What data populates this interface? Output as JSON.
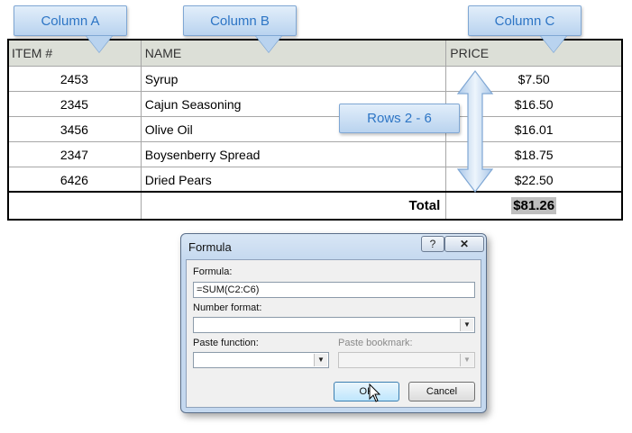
{
  "callouts": {
    "column_a": "Column A",
    "column_b": "Column B",
    "column_c": "Column C",
    "rows": "Rows 2 - 6"
  },
  "table": {
    "headers": [
      "ITEM #",
      "NAME",
      "PRICE"
    ],
    "rows": [
      {
        "item": "2453",
        "name": "Syrup",
        "price": "$7.50"
      },
      {
        "item": "2345",
        "name": "Cajun Seasoning",
        "price": "$16.50"
      },
      {
        "item": "3456",
        "name": "Olive Oil",
        "price": "$16.01"
      },
      {
        "item": "2347",
        "name": "Boysenberry Spread",
        "price": "$18.75"
      },
      {
        "item": "6426",
        "name": "Dried Pears",
        "price": "$22.50"
      }
    ],
    "total_label": "Total",
    "total_value": "$81.26"
  },
  "dialog": {
    "title": "Formula",
    "help_label": "?",
    "close_label": "✕",
    "formula_label": "Formula:",
    "formula_value": "=SUM(C2:C6)",
    "number_format_label": "Number format:",
    "number_format_value": "",
    "paste_function_label": "Paste function:",
    "paste_bookmark_label": "Paste bookmark:",
    "ok_label": "OK",
    "cancel_label": "Cancel"
  },
  "colors": {
    "callout_text": "#2d75c5",
    "header_bg": "#dcdfd7"
  }
}
